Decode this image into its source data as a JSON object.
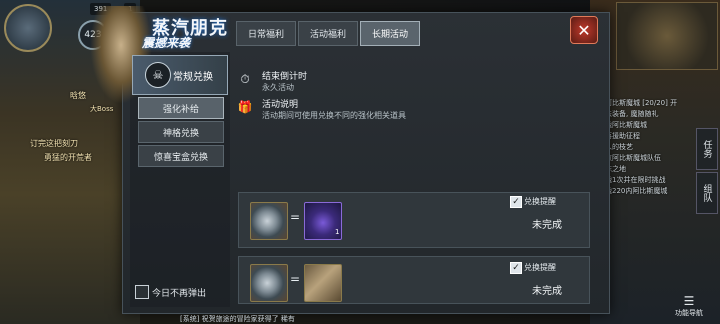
{
  "hud": {
    "resource_1": "391",
    "resource_2": "1",
    "level": "423",
    "npc_name": "晗悠",
    "npc_title": "大Boss",
    "quest_1": "订完这把刻刀",
    "quest_2": "勇猛的开荒者"
  },
  "chat": {
    "lines": [
      {
        "tag": "",
        "text": "关阿比斯魔城 [20/20] 开"
      },
      {
        "tag": "",
        "text": "魔法装备, 魔随随礼"
      },
      {
        "tag": "",
        "text": "挑战阿比斯魔城"
      },
      {
        "tag": "",
        "text": "降落援助征程"
      },
      {
        "tag": "",
        "text": "敌人的枝艺"
      },
      {
        "tag": "",
        "text": "击败阿比斯魔城队伍"
      },
      {
        "tag": "",
        "text": "试炼之地"
      },
      {
        "tag": "",
        "text": "挑战1次并在限时挑战"
      },
      {
        "tag": "",
        "text": "激战220内阿比斯魔城"
      }
    ]
  },
  "side_buttons": {
    "task": "任务",
    "team": "组队"
  },
  "event": {
    "title": "蒸汽朋克",
    "subtitle": "震撼来袭"
  },
  "tabs": [
    {
      "label": "日常福利",
      "active": false
    },
    {
      "label": "活动福利",
      "active": false
    },
    {
      "label": "长期活动",
      "active": true
    }
  ],
  "category": {
    "label": "常规兑换",
    "icon": "demon-mask-icon"
  },
  "sub_menu": [
    {
      "label": "强化补给",
      "active": true
    },
    {
      "label": "神格兑换",
      "active": false
    },
    {
      "label": "惊喜宝盒兑换",
      "active": false
    }
  ],
  "countdown": {
    "label": "结束倒计时",
    "value": "永久活动"
  },
  "description": {
    "label": "活动说明",
    "value": "活动期间可使用兑换不同的强化相关道具"
  },
  "exchange_rows": [
    {
      "input_item": "ore-icon",
      "output_item": "purple-chest-icon",
      "output_qty": "1",
      "remind_label": "兑换提醒",
      "remind_checked": true,
      "status": "未完成"
    },
    {
      "input_item": "ore-icon",
      "output_item": "hammer-icon",
      "output_qty": "",
      "remind_label": "兑换提醒",
      "remind_checked": true,
      "status": "未完成"
    }
  ],
  "equals": "=",
  "dont_show_today": "今日不再弹出",
  "bottom_chat": "[系统] 祝贺旅途的冒险家获得了 稀有",
  "nav_label": "功能导航",
  "colors": {
    "accent_tab": "#5a646c",
    "panel": "#2b3035",
    "close": "#c0392b"
  }
}
